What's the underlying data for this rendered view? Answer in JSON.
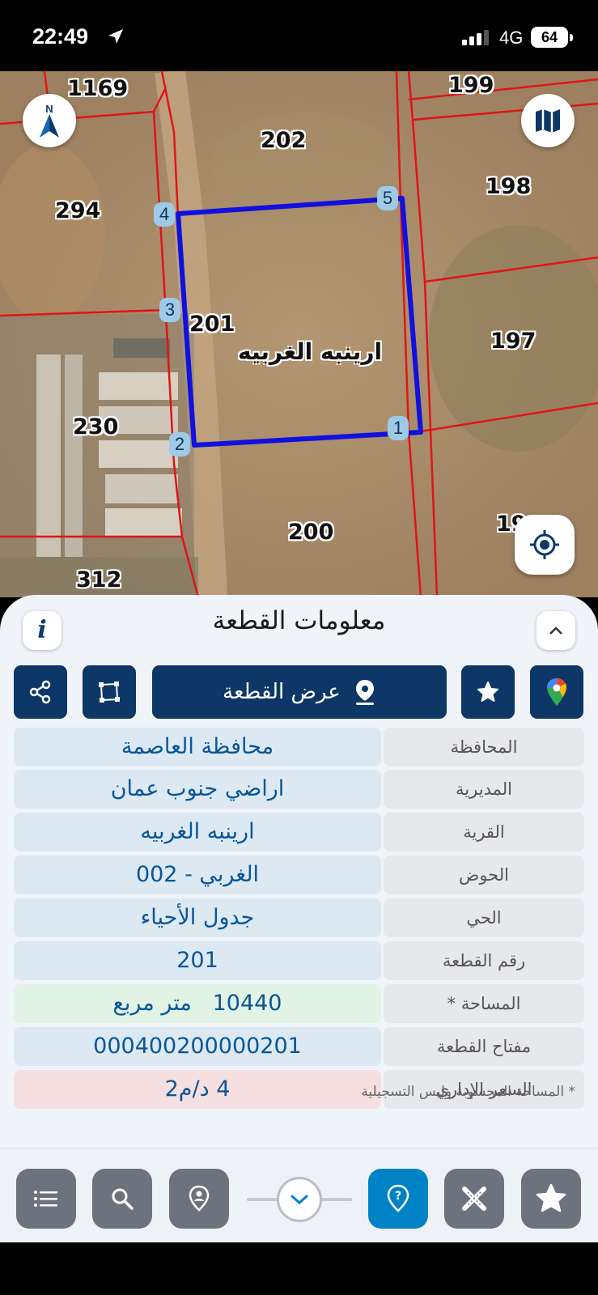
{
  "status_bar": {
    "time": "22:49",
    "network": "4G",
    "battery": "64"
  },
  "map": {
    "parcel_numbers": {
      "p1169": "1169",
      "p199": "199",
      "p202": "202",
      "p198": "198",
      "p294": "294",
      "p201": "201",
      "p197": "197",
      "p230": "230",
      "p200": "200",
      "p312": "312",
      "p19x": "19"
    },
    "village_label": "ارينبه الغربيه",
    "vertices": [
      "1",
      "2",
      "3",
      "4",
      "5"
    ],
    "north_label": "N"
  },
  "sheet": {
    "title": "معلومات القطعة",
    "show_plot_label": "عرض القطعة",
    "rows": [
      {
        "label": "المحافظة",
        "value": "محافظة العاصمة"
      },
      {
        "label": "المديرية",
        "value": "اراضي جنوب عمان"
      },
      {
        "label": "القرية",
        "value": "ارينبه الغربيه"
      },
      {
        "label": "الحوض",
        "value": "الغربي - 002"
      },
      {
        "label": "الحي",
        "value": "جدول الأحياء"
      },
      {
        "label": "رقم القطعة",
        "value": "201"
      },
      {
        "label": "المساحة *",
        "value": "10440   متر مربع"
      },
      {
        "label": "مفتاح القطعة",
        "value": "000400200000201"
      },
      {
        "label": "السعر الإداري",
        "value": "4 د/م2"
      }
    ],
    "footnote": "* المساحة المحسوبة وليس التسجيلية"
  },
  "colors": {
    "primary": "#0d3766",
    "active": "#0083c6",
    "row_blue": "#dce9f3",
    "row_green": "#e0f3e4",
    "row_red": "#f6dfe1"
  }
}
